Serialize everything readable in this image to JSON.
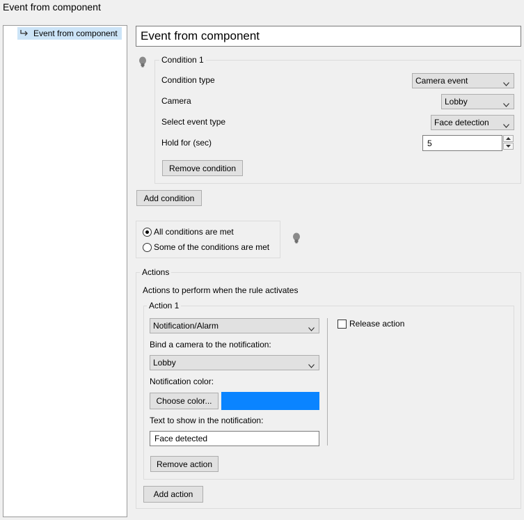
{
  "window": {
    "title": "Event from component"
  },
  "tree": {
    "items": [
      {
        "label": "Event from component",
        "icon": "rule-arrow-icon"
      }
    ]
  },
  "rule": {
    "name": "Event from component"
  },
  "condition": {
    "legend": "Condition 1",
    "type_label": "Condition type",
    "type_value": "Camera event",
    "camera_label": "Camera",
    "camera_value": "Lobby",
    "event_label": "Select event type",
    "event_value": "Face detection",
    "hold_label": "Hold for (sec)",
    "hold_value": "5",
    "remove_label": "Remove condition"
  },
  "add_condition_label": "Add condition",
  "match": {
    "options": [
      {
        "label": "All conditions are met",
        "checked": true
      },
      {
        "label": "Some of the conditions are met",
        "checked": false
      }
    ]
  },
  "actions": {
    "legend": "Actions",
    "description": "Actions to perform when the rule activates",
    "action1": {
      "legend": "Action 1",
      "type_value": "Notification/Alarm",
      "bind_camera_label": "Bind a camera to the notification:",
      "camera_value": "Lobby",
      "color_label": "Notification color:",
      "choose_color_label": "Choose color...",
      "color": "#0a84ff",
      "text_label": "Text to show in the notification:",
      "text_value": "Face detected",
      "release_label": "Release action",
      "remove_label": "Remove action"
    },
    "add_label": "Add action"
  }
}
